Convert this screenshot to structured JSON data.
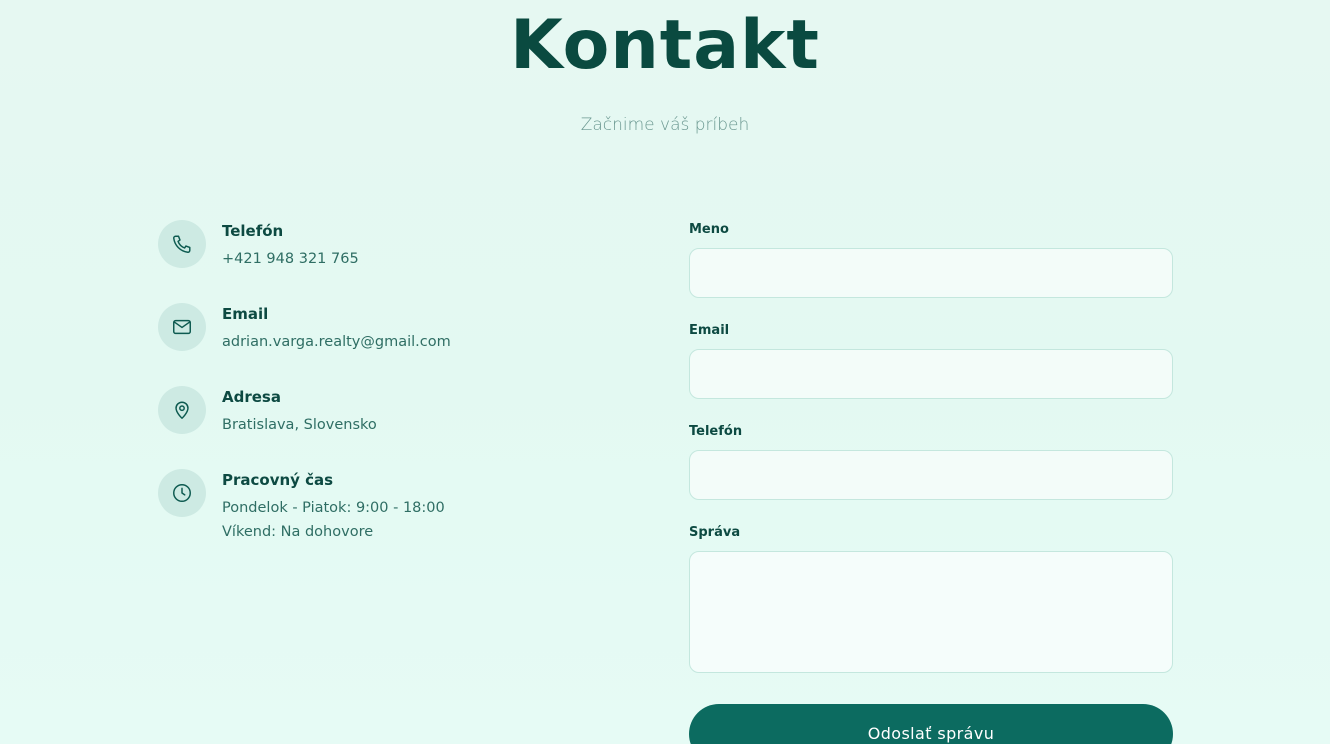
{
  "header": {
    "title": "Kontakt",
    "subtitle": "Začnime váš príbeh"
  },
  "contact_info": {
    "phone": {
      "icon": "phone-icon",
      "label": "Telefón",
      "value": "+421 948 321 765"
    },
    "email": {
      "icon": "mail-icon",
      "label": "Email",
      "value": "adrian.varga.realty@gmail.com"
    },
    "address": {
      "icon": "map-pin-icon",
      "label": "Adresa",
      "value": "Bratislava, Slovensko"
    },
    "hours": {
      "icon": "clock-icon",
      "label": "Pracovný čas",
      "value_1": "Pondelok - Piatok: 9:00 - 18:00",
      "value_2": "Víkend: Na dohovore"
    }
  },
  "form": {
    "name_label": "Meno",
    "name_value": "",
    "email_label": "Email",
    "email_value": "",
    "phone_label": "Telefón",
    "phone_value": "",
    "message_label": "Správa",
    "message_value": "",
    "submit_label": "Odoslať správu"
  },
  "colors": {
    "accent": "#0c6b60",
    "heading": "#0a4a40",
    "icon_bg": "#cdeae3",
    "input_border": "#c4e7de"
  }
}
